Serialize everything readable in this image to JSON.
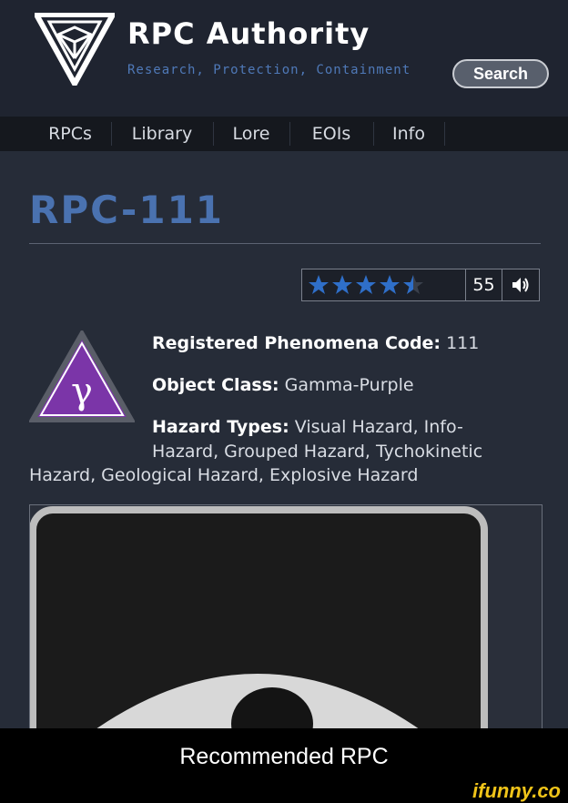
{
  "site": {
    "title": "RPC Authority",
    "tagline": "Research, Protection, Containment",
    "search_label": "Search"
  },
  "nav": {
    "items": [
      "RPCs",
      "Library",
      "Lore",
      "EOIs",
      "Info"
    ]
  },
  "page": {
    "title": "RPC-111"
  },
  "rating": {
    "stars": 4.5,
    "max_stars": 5,
    "votes": "55",
    "star_color": "#2f6fc9"
  },
  "object_class_icon": {
    "symbol": "γ",
    "fill_color": "#7b35a8"
  },
  "info": {
    "code_label": "Registered Phenomena Code:",
    "code_value": "111",
    "class_label": "Object Class:",
    "class_value": "Gamma-Purple",
    "hazard_label": "Hazard Types:",
    "hazard_line1": "Visual Hazard, Info-",
    "hazard_line2": "Hazard, Grouped Hazard, Tychokinetic",
    "hazard_line3": "Hazard, Geological Hazard, Explosive Hazard"
  },
  "caption": "Recommended RPC",
  "watermark": "ifunny.co"
}
